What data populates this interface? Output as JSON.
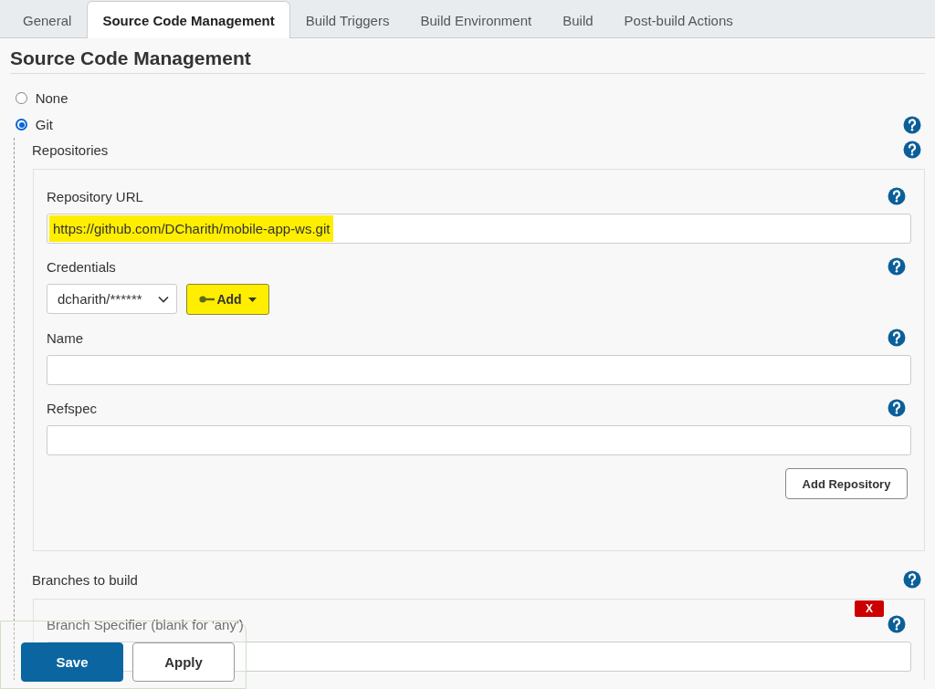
{
  "tabs": [
    {
      "label": "General",
      "selected": false
    },
    {
      "label": "Source Code Management",
      "selected": true
    },
    {
      "label": "Build Triggers",
      "selected": false
    },
    {
      "label": "Build Environment",
      "selected": false
    },
    {
      "label": "Build",
      "selected": false
    },
    {
      "label": "Post-build Actions",
      "selected": false
    }
  ],
  "section": {
    "title": "Source Code Management"
  },
  "scm_options": [
    {
      "label": "None",
      "selected": false
    },
    {
      "label": "Git",
      "selected": true
    }
  ],
  "repositories": {
    "label": "Repositories",
    "fields": [
      {
        "kind": "text",
        "label": "Repository URL",
        "value": "https://github.com/DCharith/mobile-app-ws.git",
        "highlighted": true
      },
      {
        "kind": "select",
        "label": "Credentials",
        "value": "dcharith/******",
        "add_button": {
          "label": "Add",
          "highlighted": true
        }
      },
      {
        "kind": "text",
        "label": "Name"
      },
      {
        "kind": "text",
        "label": "Refspec"
      }
    ],
    "add_repository_button": "Add Repository"
  },
  "branches": {
    "label": "Branches to build",
    "delete_button": "X",
    "fields": [
      {
        "kind": "text",
        "label": "Branch Specifier (blank for 'any')"
      }
    ]
  },
  "actions": [
    {
      "label": "Save",
      "primary": true
    },
    {
      "label": "Apply",
      "primary": false
    }
  ]
}
